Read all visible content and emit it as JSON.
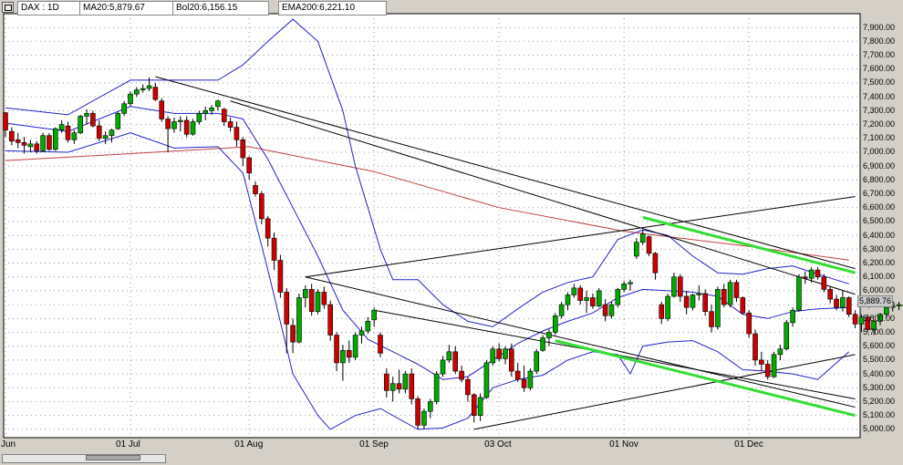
{
  "header": {
    "tab_symbol": "DAX : 1D",
    "tab_ma": "MA20:5,879.67",
    "tab_bol": "Bol20:6,156.15",
    "tab_ema": "EMA200:6,221.10"
  },
  "last_price_label": "5,889.76",
  "colors": {
    "panel_bg": "#ffffff",
    "frame": "#d4d0c8",
    "bull": "#00aa00",
    "bear": "#cc0000",
    "bollinger": "#2222cc",
    "ema200": "#c04040",
    "trendline": "#000000",
    "channel_highlight": "#33dd33"
  },
  "chart_data": {
    "type": "candlestick",
    "title": "DAX : 1D",
    "indicators": [
      "MA20",
      "Bollinger Bands 20",
      "EMA200"
    ],
    "ylim": [
      4940,
      8000
    ],
    "y_ticks": [
      5000,
      5100,
      5200,
      5300,
      5400,
      5500,
      5600,
      5700,
      5800,
      5900,
      6000,
      6100,
      6200,
      6300,
      6400,
      6500,
      6600,
      6700,
      6800,
      6900,
      7000,
      7100,
      7200,
      7300,
      7400,
      7500,
      7600,
      7700,
      7800,
      7900
    ],
    "y_tick_labels": [
      "5,000.00",
      "5,100.00",
      "5,200.00",
      "5,300.00",
      "5,400.00",
      "5,500.00",
      "5,600.00",
      "5,700.00",
      "5,800.00",
      "5,900.00",
      "6,000.00",
      "6,100.00",
      "6,200.00",
      "6,300.00",
      "6,400.00",
      "6,500.00",
      "6,600.00",
      "6,700.00",
      "6,800.00",
      "6,900.00",
      "7,000.00",
      "7,100.00",
      "7,200.00",
      "7,300.00",
      "7,400.00",
      "7,500.00",
      "7,600.00",
      "7,700.00",
      "7,800.00",
      "7,900.00"
    ],
    "x_tick_labels": [
      {
        "label": "Jun",
        "bar": 0
      },
      {
        "label": "01 Jul",
        "bar": 20
      },
      {
        "label": "01 Aug",
        "bar": 39
      },
      {
        "label": "01 Sep",
        "bar": 59
      },
      {
        "label": "03 Oct",
        "bar": 79
      },
      {
        "label": "01 Nov",
        "bar": 99
      },
      {
        "label": "01 Dec",
        "bar": 119
      }
    ],
    "bar_count": 136,
    "candles": [
      [
        7285,
        7290,
        7110,
        7160
      ],
      [
        7150,
        7180,
        7050,
        7080
      ],
      [
        7090,
        7140,
        7030,
        7070
      ],
      [
        7070,
        7110,
        6990,
        7050
      ],
      [
        7040,
        7090,
        7000,
        7060
      ],
      [
        7060,
        7080,
        6990,
        7010
      ],
      [
        7010,
        7140,
        7000,
        7120
      ],
      [
        7120,
        7140,
        7010,
        7020
      ],
      [
        7020,
        7180,
        7010,
        7170
      ],
      [
        7160,
        7230,
        7140,
        7200
      ],
      [
        7190,
        7220,
        7070,
        7090
      ],
      [
        7090,
        7160,
        7060,
        7140
      ],
      [
        7140,
        7270,
        7130,
        7260
      ],
      [
        7260,
        7310,
        7200,
        7280
      ],
      [
        7280,
        7300,
        7180,
        7190
      ],
      [
        7190,
        7230,
        7080,
        7100
      ],
      [
        7100,
        7150,
        7060,
        7120
      ],
      [
        7120,
        7170,
        7070,
        7160
      ],
      [
        7170,
        7290,
        7160,
        7280
      ],
      [
        7280,
        7370,
        7260,
        7350
      ],
      [
        7350,
        7440,
        7330,
        7420
      ],
      [
        7420,
        7470,
        7400,
        7450
      ],
      [
        7450,
        7490,
        7430,
        7460
      ],
      [
        7460,
        7540,
        7440,
        7480
      ],
      [
        7470,
        7500,
        7370,
        7380
      ],
      [
        7370,
        7390,
        7220,
        7240
      ],
      [
        7240,
        7260,
        7000,
        7170
      ],
      [
        7170,
        7250,
        7140,
        7220
      ],
      [
        7220,
        7260,
        7150,
        7230
      ],
      [
        7230,
        7260,
        7110,
        7130
      ],
      [
        7130,
        7240,
        7120,
        7220
      ],
      [
        7220,
        7300,
        7200,
        7280
      ],
      [
        7280,
        7330,
        7230,
        7300
      ],
      [
        7300,
        7340,
        7270,
        7320
      ],
      [
        7330,
        7380,
        7300,
        7370
      ],
      [
        7310,
        7320,
        7190,
        7220
      ],
      [
        7220,
        7250,
        7150,
        7180
      ],
      [
        7180,
        7220,
        7040,
        7090
      ],
      [
        7090,
        7110,
        6900,
        6960
      ],
      [
        6960,
        6970,
        6800,
        6850
      ],
      [
        6760,
        6790,
        6680,
        6700
      ],
      [
        6700,
        6720,
        6480,
        6520
      ],
      [
        6520,
        6540,
        6320,
        6380
      ],
      [
        6380,
        6420,
        6150,
        6220
      ],
      [
        6220,
        6260,
        5950,
        5990
      ],
      [
        5990,
        6020,
        5550,
        5760
      ],
      [
        5750,
        5800,
        5550,
        5630
      ],
      [
        5630,
        5980,
        5620,
        5950
      ],
      [
        5950,
        6040,
        5880,
        6010
      ],
      [
        6010,
        6050,
        5820,
        5850
      ],
      [
        5850,
        6010,
        5830,
        5990
      ],
      [
        5990,
        6030,
        5870,
        5900
      ],
      [
        5900,
        5930,
        5640,
        5680
      ],
      [
        5680,
        5700,
        5420,
        5480
      ],
      [
        5480,
        5610,
        5350,
        5570
      ],
      [
        5570,
        5640,
        5480,
        5520
      ],
      [
        5520,
        5700,
        5500,
        5680
      ],
      [
        5680,
        5740,
        5620,
        5710
      ],
      [
        5710,
        5810,
        5690,
        5780
      ],
      [
        5790,
        5880,
        5740,
        5860
      ],
      [
        5680,
        5700,
        5520,
        5550
      ],
      [
        5400,
        5440,
        5230,
        5280
      ],
      [
        5280,
        5380,
        5200,
        5330
      ],
      [
        5330,
        5430,
        5260,
        5290
      ],
      [
        5290,
        5420,
        5260,
        5400
      ],
      [
        5400,
        5440,
        5180,
        5220
      ],
      [
        5220,
        5240,
        5000,
        5030
      ],
      [
        5030,
        5150,
        5000,
        5130
      ],
      [
        5130,
        5220,
        5080,
        5200
      ],
      [
        5200,
        5420,
        5180,
        5400
      ],
      [
        5400,
        5530,
        5380,
        5500
      ],
      [
        5500,
        5610,
        5480,
        5560
      ],
      [
        5560,
        5600,
        5400,
        5420
      ],
      [
        5420,
        5460,
        5340,
        5360
      ],
      [
        5360,
        5380,
        5200,
        5250
      ],
      [
        5250,
        5260,
        5050,
        5100
      ],
      [
        5100,
        5260,
        5060,
        5230
      ],
      [
        5230,
        5500,
        5220,
        5480
      ],
      [
        5480,
        5600,
        5460,
        5580
      ],
      [
        5580,
        5620,
        5490,
        5510
      ],
      [
        5510,
        5600,
        5470,
        5580
      ],
      [
        5580,
        5620,
        5380,
        5420
      ],
      [
        5420,
        5480,
        5340,
        5360
      ],
      [
        5360,
        5460,
        5270,
        5300
      ],
      [
        5300,
        5440,
        5280,
        5420
      ],
      [
        5420,
        5580,
        5400,
        5560
      ],
      [
        5570,
        5680,
        5560,
        5660
      ],
      [
        5660,
        5720,
        5600,
        5700
      ],
      [
        5700,
        5840,
        5680,
        5820
      ],
      [
        5820,
        5920,
        5800,
        5900
      ],
      [
        5900,
        5990,
        5860,
        5970
      ],
      [
        5970,
        6050,
        5950,
        6020
      ],
      [
        6020,
        6040,
        5900,
        5930
      ],
      [
        5930,
        6000,
        5840,
        5950
      ],
      [
        5950,
        5980,
        5870,
        5890
      ],
      [
        5890,
        6020,
        5880,
        6000
      ],
      [
        5900,
        5940,
        5780,
        5820
      ],
      [
        5820,
        5920,
        5800,
        5900
      ],
      [
        5900,
        6020,
        5880,
        6010
      ],
      [
        6010,
        6070,
        5990,
        6050
      ],
      [
        6050,
        6080,
        6000,
        6060
      ],
      [
        6250,
        6380,
        6230,
        6350
      ],
      [
        6350,
        6440,
        6330,
        6410
      ],
      [
        6390,
        6400,
        6250,
        6270
      ],
      [
        6270,
        6280,
        6080,
        6130
      ],
      [
        5900,
        5920,
        5760,
        5800
      ],
      [
        5800,
        5980,
        5780,
        5960
      ],
      [
        5960,
        6130,
        5950,
        6100
      ],
      [
        6100,
        6120,
        5920,
        5960
      ],
      [
        5960,
        6000,
        5830,
        5880
      ],
      [
        5880,
        5980,
        5860,
        5970
      ],
      [
        5970,
        6040,
        5930,
        5980
      ],
      [
        5980,
        6010,
        5820,
        5850
      ],
      [
        5850,
        5900,
        5700,
        5740
      ],
      [
        5740,
        6030,
        5720,
        6010
      ],
      [
        6010,
        6050,
        5880,
        5900
      ],
      [
        5900,
        6080,
        5880,
        6060
      ],
      [
        6060,
        6080,
        5920,
        5950
      ],
      [
        5950,
        5960,
        5830,
        5840
      ],
      [
        5840,
        5860,
        5660,
        5690
      ],
      [
        5690,
        5720,
        5460,
        5500
      ],
      [
        5500,
        5560,
        5420,
        5470
      ],
      [
        5470,
        5500,
        5360,
        5380
      ],
      [
        5380,
        5560,
        5370,
        5540
      ],
      [
        5540,
        5610,
        5500,
        5580
      ],
      [
        5580,
        5790,
        5570,
        5770
      ],
      [
        5770,
        5880,
        5740,
        5860
      ],
      [
        5860,
        6120,
        5850,
        6100
      ],
      [
        6100,
        6140,
        6050,
        6090
      ],
      [
        6090,
        6170,
        6060,
        6150
      ],
      [
        6150,
        6170,
        6080,
        6100
      ],
      [
        6100,
        6120,
        5990,
        6010
      ],
      [
        6010,
        6030,
        5910,
        5940
      ],
      [
        5940,
        5970,
        5860,
        5880
      ],
      [
        5880,
        6000,
        5850,
        5950
      ],
      [
        5950,
        5960,
        5810,
        5830
      ],
      [
        5830,
        5860,
        5730,
        5760
      ],
      [
        5760,
        5830,
        5700,
        5810
      ],
      [
        5810,
        5830,
        5700,
        5720
      ],
      [
        5720,
        5790,
        5680,
        5780
      ],
      [
        5780,
        5840,
        5750,
        5830
      ],
      [
        5830,
        5900,
        5800,
        5880
      ],
      [
        5880,
        5920,
        5850,
        5890
      ],
      [
        5890,
        5920,
        5860,
        5900
      ],
      [
        5900,
        5910,
        5870,
        5890
      ]
    ],
    "ema200": [
      [
        0,
        6940
      ],
      [
        20,
        6990
      ],
      [
        39,
        7040
      ],
      [
        59,
        6860
      ],
      [
        79,
        6600
      ],
      [
        99,
        6430
      ],
      [
        119,
        6320
      ],
      [
        135,
        6221
      ]
    ],
    "bollinger_upper": [
      [
        0,
        7320
      ],
      [
        10,
        7270
      ],
      [
        20,
        7520
      ],
      [
        27,
        7520
      ],
      [
        34,
        7520
      ],
      [
        38,
        7630
      ],
      [
        42,
        7800
      ],
      [
        46,
        7960
      ],
      [
        50,
        7800
      ],
      [
        54,
        7300
      ],
      [
        56,
        6900
      ],
      [
        58,
        6600
      ],
      [
        60,
        6300
      ],
      [
        62,
        6080
      ],
      [
        66,
        6080
      ],
      [
        70,
        5900
      ],
      [
        74,
        5780
      ],
      [
        78,
        5740
      ],
      [
        82,
        5870
      ],
      [
        86,
        5990
      ],
      [
        90,
        6060
      ],
      [
        94,
        6100
      ],
      [
        98,
        6370
      ],
      [
        102,
        6440
      ],
      [
        106,
        6400
      ],
      [
        110,
        6250
      ],
      [
        114,
        6130
      ],
      [
        118,
        6120
      ],
      [
        122,
        6160
      ],
      [
        126,
        6180
      ],
      [
        130,
        6120
      ],
      [
        135,
        6050
      ]
    ],
    "bollinger_middle": [
      [
        0,
        7210
      ],
      [
        10,
        7150
      ],
      [
        20,
        7330
      ],
      [
        27,
        7280
      ],
      [
        34,
        7280
      ],
      [
        38,
        7240
      ],
      [
        42,
        6950
      ],
      [
        46,
        6600
      ],
      [
        50,
        6250
      ],
      [
        54,
        5860
      ],
      [
        58,
        5650
      ],
      [
        62,
        5560
      ],
      [
        66,
        5470
      ],
      [
        70,
        5360
      ],
      [
        74,
        5380
      ],
      [
        78,
        5500
      ],
      [
        82,
        5620
      ],
      [
        86,
        5710
      ],
      [
        90,
        5780
      ],
      [
        94,
        5840
      ],
      [
        98,
        5950
      ],
      [
        102,
        6010
      ],
      [
        106,
        6000
      ],
      [
        110,
        5990
      ],
      [
        114,
        5960
      ],
      [
        118,
        5830
      ],
      [
        122,
        5800
      ],
      [
        126,
        5850
      ],
      [
        130,
        5870
      ],
      [
        135,
        5880
      ]
    ],
    "bollinger_lower": [
      [
        0,
        7010
      ],
      [
        10,
        7000
      ],
      [
        20,
        7140
      ],
      [
        27,
        7030
      ],
      [
        34,
        7040
      ],
      [
        38,
        6850
      ],
      [
        42,
        6150
      ],
      [
        46,
        5400
      ],
      [
        50,
        5100
      ],
      [
        52,
        5000
      ],
      [
        56,
        5100
      ],
      [
        60,
        5150
      ],
      [
        66,
        5000
      ],
      [
        70,
        5010
      ],
      [
        74,
        5080
      ],
      [
        78,
        5300
      ],
      [
        82,
        5360
      ],
      [
        86,
        5390
      ],
      [
        90,
        5500
      ],
      [
        94,
        5560
      ],
      [
        98,
        5540
      ],
      [
        100,
        5400
      ],
      [
        102,
        5600
      ],
      [
        106,
        5630
      ],
      [
        110,
        5640
      ],
      [
        114,
        5560
      ],
      [
        118,
        5430
      ],
      [
        122,
        5420
      ],
      [
        126,
        5400
      ],
      [
        130,
        5360
      ],
      [
        135,
        5560
      ]
    ],
    "trendlines": [
      {
        "from": [
          24,
          7545
        ],
        "to": [
          136,
          6160
        ],
        "color": "trendline"
      },
      {
        "from": [
          36,
          7370
        ],
        "to": [
          136,
          5975
        ],
        "color": "trendline"
      },
      {
        "from": [
          48,
          6100
        ],
        "to": [
          136,
          5160
        ],
        "color": "trendline"
      },
      {
        "from": [
          59,
          5860
        ],
        "to": [
          136,
          5220
        ],
        "color": "trendline"
      },
      {
        "from": [
          48,
          6100
        ],
        "to": [
          98,
          6430
        ],
        "color": "trendline"
      },
      {
        "from": [
          98,
          6430
        ],
        "to": [
          136,
          6680
        ],
        "color": "trendline"
      },
      {
        "from": [
          75,
          5000
        ],
        "to": [
          136,
          5540
        ],
        "color": "trendline"
      },
      {
        "from": [
          102,
          6530
        ],
        "to": [
          136,
          6130
        ],
        "color": "channel_highlight"
      },
      {
        "from": [
          88,
          5640
        ],
        "to": [
          136,
          5100
        ],
        "color": "channel_highlight"
      }
    ]
  },
  "scrollbar": {
    "track": "scroll-track"
  }
}
